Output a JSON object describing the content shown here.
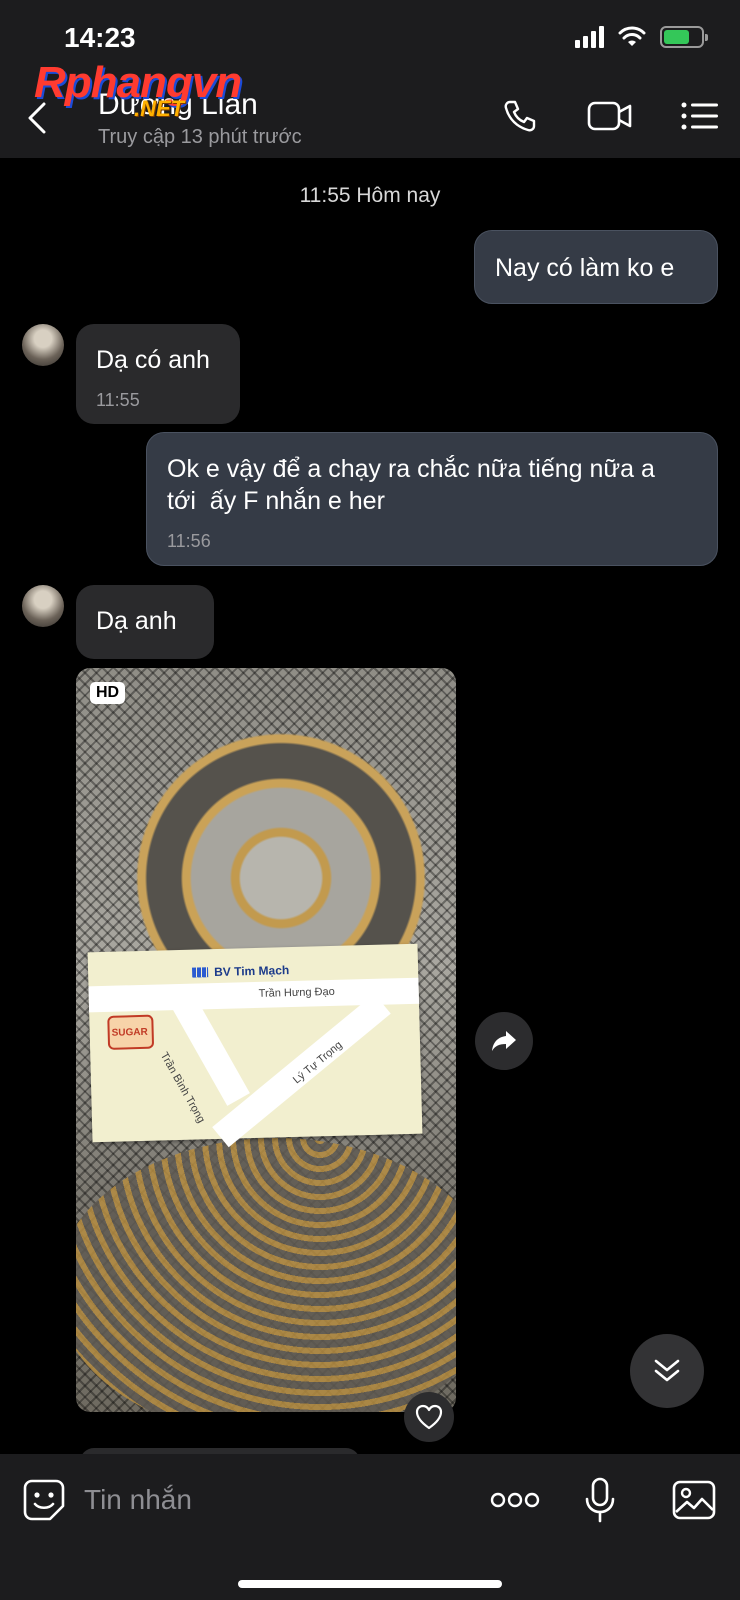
{
  "status_bar": {
    "time": "14:23",
    "battery_level": 0.7
  },
  "watermark": {
    "brand": "Rphangvn",
    "suffix": ".NET"
  },
  "header": {
    "contact_name": "Dương Lian",
    "contact_status": "Truy cập 13 phút trước",
    "icons": [
      "back-chevron-icon",
      "phone-icon",
      "video-camera-icon",
      "list-menu-icon"
    ]
  },
  "chat": {
    "date_separator": "11:55 Hôm nay",
    "messages": [
      {
        "direction": "out",
        "text": "Nay có làm ko e"
      },
      {
        "direction": "in",
        "text": "Dạ có anh",
        "time": "11:55"
      },
      {
        "direction": "out",
        "text_line1": "Ok e vậy để a chạy ra chắc nữa tiếng nữa a",
        "text_line2": "tới  ấy F nhắn e her",
        "time": "11:56"
      },
      {
        "direction": "in",
        "text": "Dạ anh"
      }
    ],
    "photo": {
      "badge": "HD",
      "card_title": "BV Tim Mạch",
      "street_1": "Trần Hưng Đạo",
      "street_2": "Trần Bình Trọng",
      "street_3": "Lý Tự Trọng",
      "logo_text": "SUGAR"
    }
  },
  "input_bar": {
    "placeholder": "Tin nhắn",
    "icons": [
      "emoji-sticker-icon",
      "more-dots-icon",
      "microphone-icon",
      "image-gallery-icon"
    ]
  },
  "colors": {
    "outgoing_bubble": "#353b46",
    "incoming_bubble": "#2a2a2c",
    "background": "#000000",
    "header": "#1c1c1e"
  }
}
